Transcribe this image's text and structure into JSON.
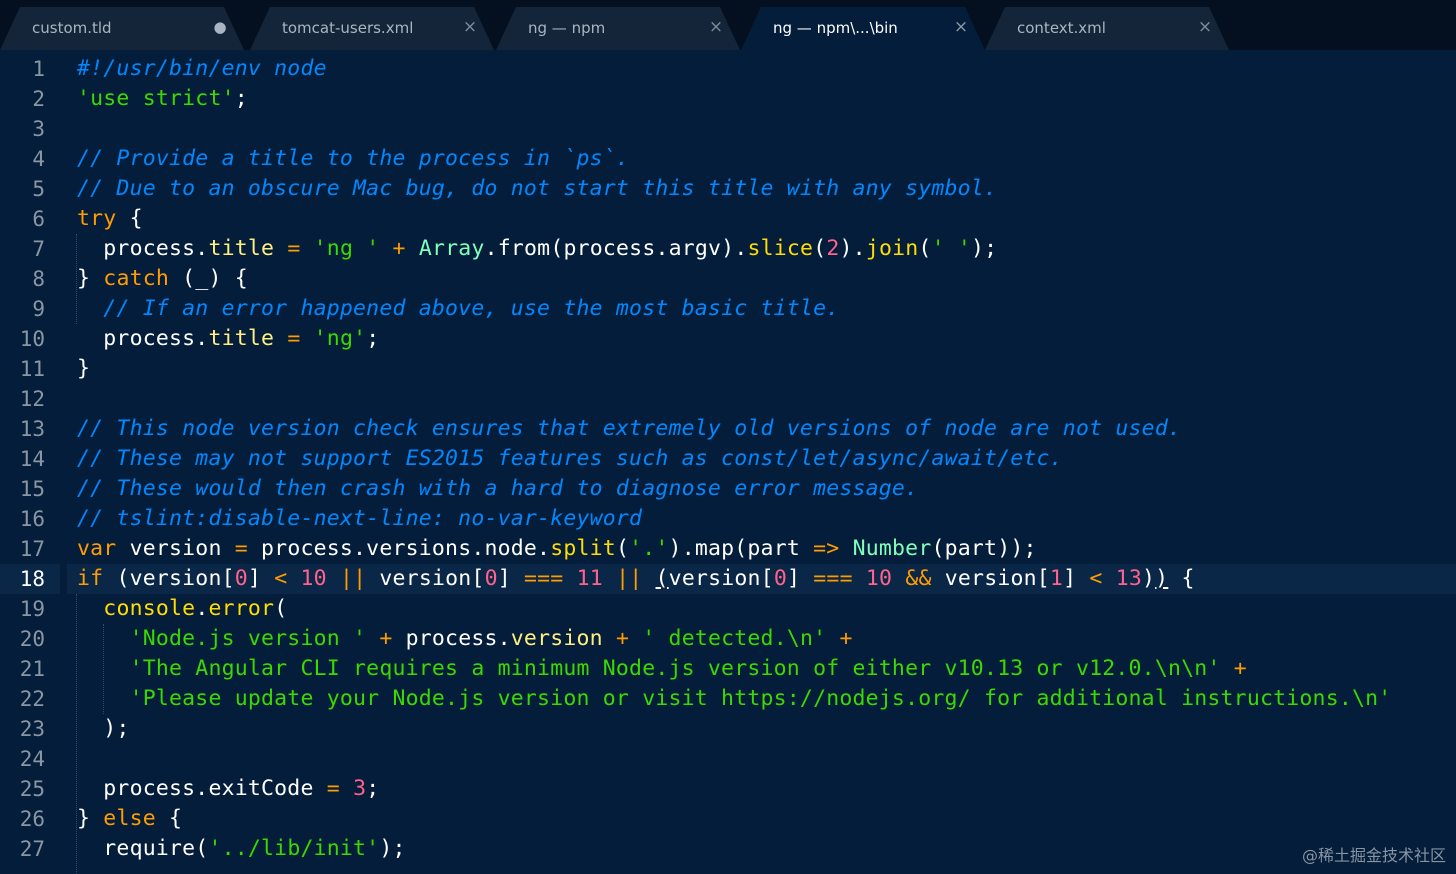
{
  "tabs": [
    {
      "label": "custom.tld",
      "close": "●",
      "active": false
    },
    {
      "label": "tomcat-users.xml",
      "close": "×",
      "active": false
    },
    {
      "label": "ng — npm",
      "close": "×",
      "active": false
    },
    {
      "label": "ng — npm\\...\\bin",
      "close": "×",
      "active": true
    },
    {
      "label": "context.xml",
      "close": "×",
      "active": false
    }
  ],
  "editor": {
    "current_line": 18,
    "line_numbers": [
      "1",
      "2",
      "3",
      "4",
      "5",
      "6",
      "7",
      "8",
      "9",
      "10",
      "11",
      "12",
      "13",
      "14",
      "15",
      "16",
      "17",
      "18",
      "19",
      "20",
      "21",
      "22",
      "23",
      "24",
      "25",
      "26",
      "27"
    ],
    "lines": [
      [
        [
          "c",
          "#!/usr/bin/env node"
        ]
      ],
      [
        [
          "s",
          "'use strict'"
        ],
        [
          "t",
          ";"
        ]
      ],
      [],
      [
        [
          "c",
          "// Provide a title to the process in `ps`."
        ]
      ],
      [
        [
          "c",
          "// Due to an obscure Mac bug, do not start this title with any symbol."
        ]
      ],
      [
        [
          "k",
          "try"
        ],
        [
          "t",
          " {"
        ]
      ],
      [
        [
          "t",
          "  process."
        ],
        [
          "p",
          "title"
        ],
        [
          "t",
          " "
        ],
        [
          "o",
          "="
        ],
        [
          "t",
          " "
        ],
        [
          "s",
          "'ng '"
        ],
        [
          "t",
          " "
        ],
        [
          "o",
          "+"
        ],
        [
          "t",
          " "
        ],
        [
          "b",
          "Array"
        ],
        [
          "t",
          ".from(process.argv)."
        ],
        [
          "f",
          "slice"
        ],
        [
          "t",
          "("
        ],
        [
          "n",
          "2"
        ],
        [
          "t",
          ")."
        ],
        [
          "f",
          "join"
        ],
        [
          "t",
          "("
        ],
        [
          "s",
          "' '"
        ],
        [
          "t",
          ");"
        ]
      ],
      [
        [
          "t",
          "} "
        ],
        [
          "k",
          "catch"
        ],
        [
          "t",
          " (_) {"
        ]
      ],
      [
        [
          "t",
          "  "
        ],
        [
          "c",
          "// If an error happened above, use the most basic title."
        ]
      ],
      [
        [
          "t",
          "  process."
        ],
        [
          "p",
          "title"
        ],
        [
          "t",
          " "
        ],
        [
          "o",
          "="
        ],
        [
          "t",
          " "
        ],
        [
          "s",
          "'ng'"
        ],
        [
          "t",
          ";"
        ]
      ],
      [
        [
          "t",
          "}"
        ]
      ],
      [],
      [
        [
          "c",
          "// This node version check ensures that extremely old versions of node are not used."
        ]
      ],
      [
        [
          "c",
          "// These may not support ES2015 features such as const/let/async/await/etc."
        ]
      ],
      [
        [
          "c",
          "// These would then crash with a hard to diagnose error message."
        ]
      ],
      [
        [
          "c",
          "// tslint:disable-next-line: no-var-keyword"
        ]
      ],
      [
        [
          "k",
          "var"
        ],
        [
          "t",
          " version "
        ],
        [
          "o",
          "="
        ],
        [
          "t",
          " process.versions.node."
        ],
        [
          "f",
          "split"
        ],
        [
          "t",
          "("
        ],
        [
          "s",
          "'.'"
        ],
        [
          "t",
          ").map(part "
        ],
        [
          "o",
          "=>"
        ],
        [
          "t",
          " "
        ],
        [
          "b",
          "Number"
        ],
        [
          "t",
          "(part));"
        ]
      ],
      [
        [
          "k",
          "if"
        ],
        [
          "t",
          " (version["
        ],
        [
          "n",
          "0"
        ],
        [
          "t",
          "] "
        ],
        [
          "o",
          "<"
        ],
        [
          "t",
          " "
        ],
        [
          "n",
          "10"
        ],
        [
          "t",
          " "
        ],
        [
          "o",
          "||"
        ],
        [
          "t",
          " version["
        ],
        [
          "n",
          "0"
        ],
        [
          "t",
          "] "
        ],
        [
          "o",
          "==="
        ],
        [
          "t",
          " "
        ],
        [
          "n",
          "11"
        ],
        [
          "t",
          " "
        ],
        [
          "o",
          "||"
        ],
        [
          "t",
          " "
        ],
        [
          "u",
          "("
        ],
        [
          "t",
          "version["
        ],
        [
          "n",
          "0"
        ],
        [
          "t",
          "] "
        ],
        [
          "o",
          "==="
        ],
        [
          "t",
          " "
        ],
        [
          "n",
          "10"
        ],
        [
          "t",
          " "
        ],
        [
          "o",
          "&&"
        ],
        [
          "t",
          " version["
        ],
        [
          "n",
          "1"
        ],
        [
          "t",
          "] "
        ],
        [
          "o",
          "<"
        ],
        [
          "t",
          " "
        ],
        [
          "n",
          "13"
        ],
        [
          "t",
          ")"
        ],
        [
          "u",
          ")"
        ],
        [
          "t",
          " {"
        ]
      ],
      [
        [
          "t",
          "  "
        ],
        [
          "f",
          "console"
        ],
        [
          "t",
          "."
        ],
        [
          "f",
          "error"
        ],
        [
          "t",
          "("
        ]
      ],
      [
        [
          "t",
          "    "
        ],
        [
          "s",
          "'Node.js version '"
        ],
        [
          "t",
          " "
        ],
        [
          "o",
          "+"
        ],
        [
          "t",
          " process."
        ],
        [
          "p",
          "version"
        ],
        [
          "t",
          " "
        ],
        [
          "o",
          "+"
        ],
        [
          "t",
          " "
        ],
        [
          "s",
          "' detected.\\n'"
        ],
        [
          "t",
          " "
        ],
        [
          "o",
          "+"
        ]
      ],
      [
        [
          "t",
          "    "
        ],
        [
          "s",
          "'The Angular CLI requires a minimum Node.js version of either v10.13 or v12.0.\\n\\n'"
        ],
        [
          "t",
          " "
        ],
        [
          "o",
          "+"
        ]
      ],
      [
        [
          "t",
          "    "
        ],
        [
          "s",
          "'Please update your Node.js version or visit https://nodejs.org/ for additional instructions.\\n'"
        ]
      ],
      [
        [
          "t",
          "  );"
        ]
      ],
      [],
      [
        [
          "t",
          "  process.exitCode "
        ],
        [
          "o",
          "="
        ],
        [
          "t",
          " "
        ],
        [
          "n",
          "3"
        ],
        [
          "t",
          ";"
        ]
      ],
      [
        [
          "t",
          "} "
        ],
        [
          "k",
          "else"
        ],
        [
          "t",
          " {"
        ]
      ],
      [
        [
          "t",
          "  require("
        ],
        [
          "s",
          "'../lib/init'"
        ],
        [
          "t",
          ");"
        ]
      ]
    ]
  },
  "watermark": "@稀土掘金技术社区",
  "colors": {
    "background": "#041d3a",
    "keyword": "#ff9d00",
    "string": "#3ad900",
    "comment": "#0088ff",
    "number": "#ff628c",
    "property": "#ffee80",
    "function": "#ffdd00",
    "builtin": "#80ffbb"
  }
}
